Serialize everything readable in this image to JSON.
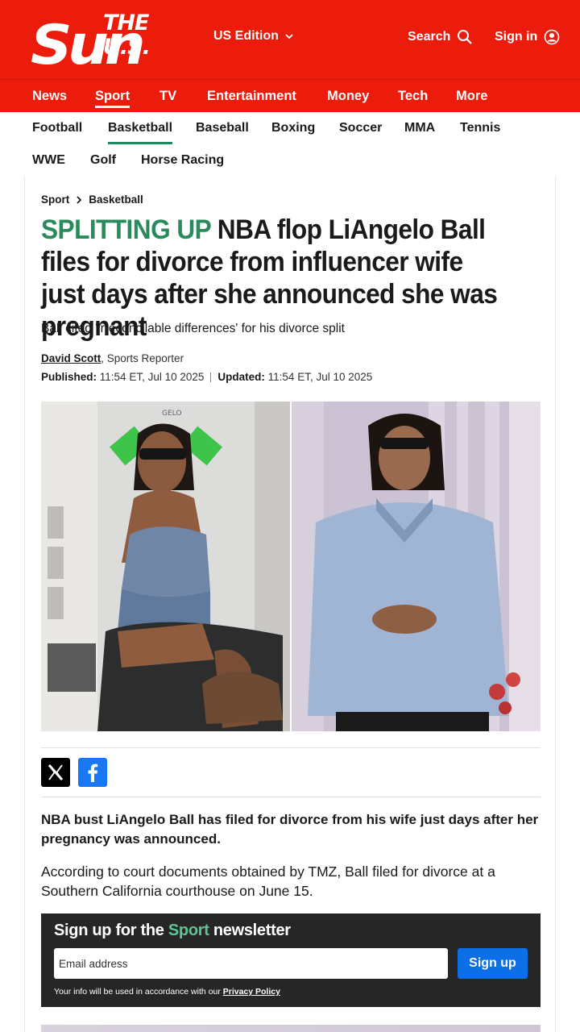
{
  "header": {
    "logo_small": "THE U.S.",
    "logo_big": "Sun",
    "edition_label": "US Edition",
    "search_label": "Search",
    "signin_label": "Sign in"
  },
  "primary_nav": [
    "News",
    "Sport",
    "TV",
    "Entertainment",
    "Money",
    "Tech",
    "More"
  ],
  "primary_active": "Sport",
  "secondary_nav": [
    "Football",
    "Basketball",
    "Baseball",
    "Boxing",
    "Soccer",
    "MMA",
    "Tennis",
    "WWE",
    "Golf",
    "Horse Racing"
  ],
  "secondary_active": "Basketball",
  "article": {
    "breadcrumb": [
      "Sport",
      "Basketball"
    ],
    "kicker": "SPLITTING UP",
    "headline": "NBA flop LiAngelo Ball files for divorce from influencer wife just days after she announced she was pregnant",
    "standfirst": "Ball cited 'irreconcilable differences' for his divorce split",
    "author": "David Scott",
    "author_role": ", Sports Reporter",
    "published_label": "Published:",
    "published_value": "11:54 ET, Jul 10 2025",
    "updated_label": "Updated:",
    "updated_value": "11:54 ET, Jul 10 2025",
    "photo_sign_text": "GELO",
    "lede": "NBA bust LiAngelo Ball has filed for divorce from his wife just days after her pregnancy was announced.",
    "paragraph": "According to court documents obtained by TMZ, Ball filed for divorce at a Southern California courthouse on June 15."
  },
  "newsletter": {
    "title_pre": "Sign up for the ",
    "title_highlight": "Sport",
    "title_post": " newsletter",
    "email_placeholder": "Email address",
    "button_label": "Sign up",
    "legal_text": "Your info will be used in accordance with our ",
    "legal_link": "Privacy Policy"
  },
  "colors": {
    "brand_red": "#eb1c0c",
    "sport_green": "#2a8a5c",
    "newsletter_bg": "#262626",
    "signup_blue": "#0c6fe6",
    "facebook_blue": "#1877f2"
  },
  "icons": [
    "chevron-down-icon",
    "search-icon",
    "user-icon",
    "chevron-right-icon",
    "x-logo-icon",
    "facebook-icon"
  ]
}
